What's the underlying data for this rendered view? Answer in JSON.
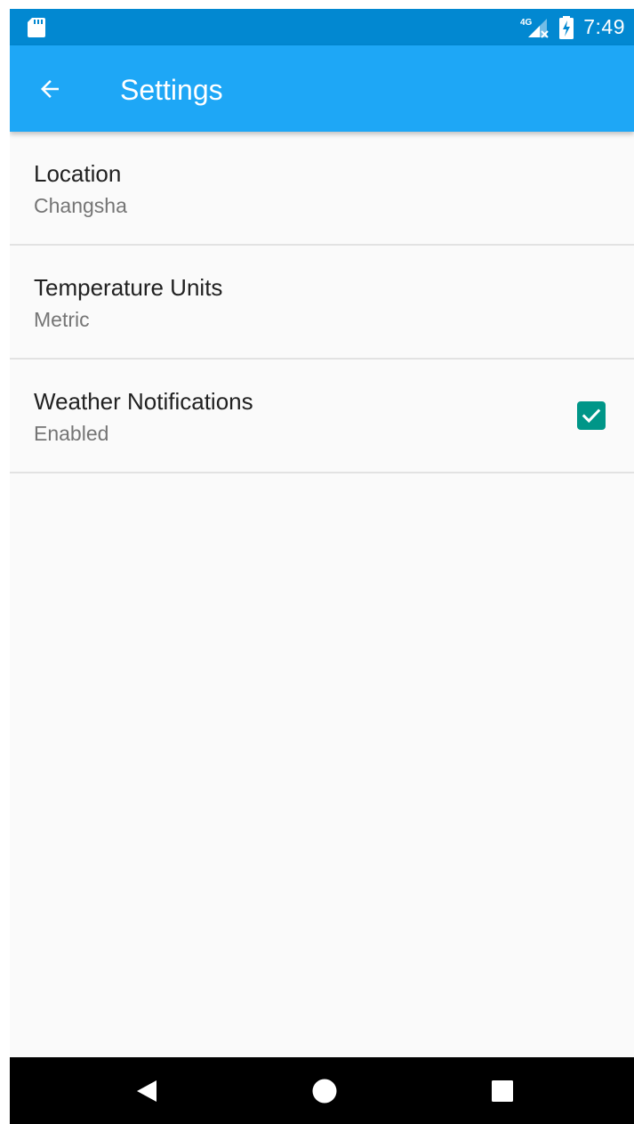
{
  "status_bar": {
    "network_type": "4G",
    "time": "7:49",
    "icons": [
      "sd-card-icon",
      "signal-no-service-icon",
      "battery-charging-icon"
    ]
  },
  "app_bar": {
    "back_icon": "arrow-back-icon",
    "title": "Settings",
    "color": "#1ea7f6"
  },
  "settings": {
    "items": [
      {
        "title": "Location",
        "summary": "Changsha"
      },
      {
        "title": "Temperature Units",
        "summary": "Metric"
      },
      {
        "title": "Weather Notifications",
        "summary": "Enabled",
        "checked": true
      }
    ]
  },
  "nav_bar": {
    "icons": [
      "nav-back-icon",
      "nav-home-icon",
      "nav-recents-icon"
    ]
  },
  "colors": {
    "status_bar": "#0288d1",
    "accent": "#009688",
    "background": "#fafafa"
  }
}
